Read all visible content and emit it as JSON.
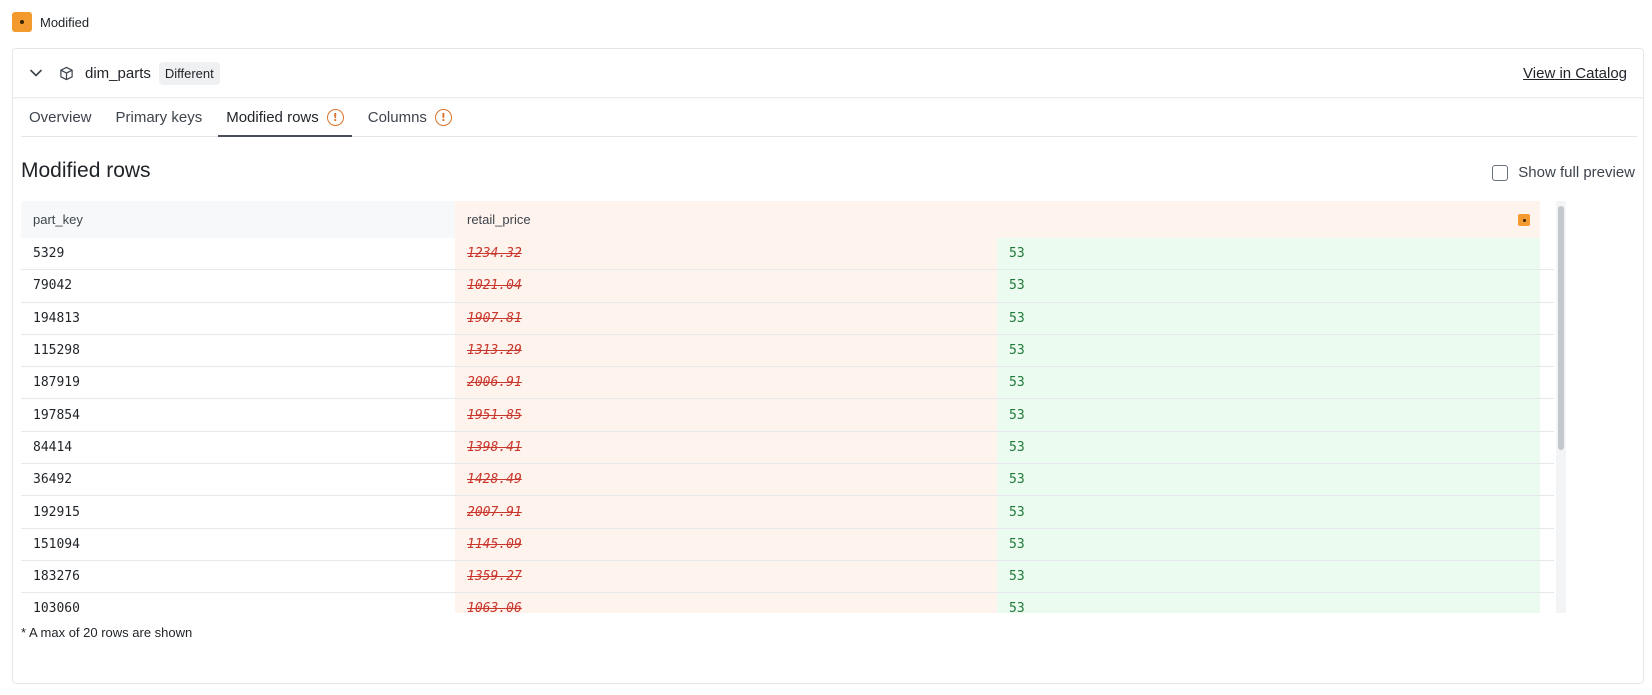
{
  "topbar": {
    "status_label": "Modified",
    "status_color": "#f29a2e"
  },
  "header": {
    "model_name": "dim_parts",
    "badge": "Different",
    "catalog_link": "View in Catalog"
  },
  "tabs": [
    {
      "label": "Overview",
      "active": false,
      "warning": false
    },
    {
      "label": "Primary keys",
      "active": false,
      "warning": false
    },
    {
      "label": "Modified rows",
      "active": true,
      "warning": true
    },
    {
      "label": "Columns",
      "active": false,
      "warning": true
    }
  ],
  "warning_glyph": "!",
  "section": {
    "title": "Modified rows",
    "preview_label": "Show full preview",
    "preview_checked": false
  },
  "grid": {
    "columns": [
      "part_key",
      "retail_price"
    ],
    "rows": [
      {
        "key": "5329",
        "old": "1234.32",
        "new": "53"
      },
      {
        "key": "79042",
        "old": "1021.04",
        "new": "53"
      },
      {
        "key": "194813",
        "old": "1907.81",
        "new": "53"
      },
      {
        "key": "115298",
        "old": "1313.29",
        "new": "53"
      },
      {
        "key": "187919",
        "old": "2006.91",
        "new": "53"
      },
      {
        "key": "197854",
        "old": "1951.85",
        "new": "53"
      },
      {
        "key": "84414",
        "old": "1398.41",
        "new": "53"
      },
      {
        "key": "36492",
        "old": "1428.49",
        "new": "53"
      },
      {
        "key": "192915",
        "old": "2007.91",
        "new": "53"
      },
      {
        "key": "151094",
        "old": "1145.09",
        "new": "53"
      },
      {
        "key": "183276",
        "old": "1359.27",
        "new": "53"
      },
      {
        "key": "103060",
        "old": "1063.06",
        "new": "53"
      }
    ]
  },
  "footnote": "* A max of 20 rows are shown",
  "colors": {
    "removed_bg": "#fff3ee",
    "removed_text": "#c8362c",
    "added_bg": "#ebfbef",
    "added_text": "#1f7a3a",
    "warning": "#d9742b"
  }
}
